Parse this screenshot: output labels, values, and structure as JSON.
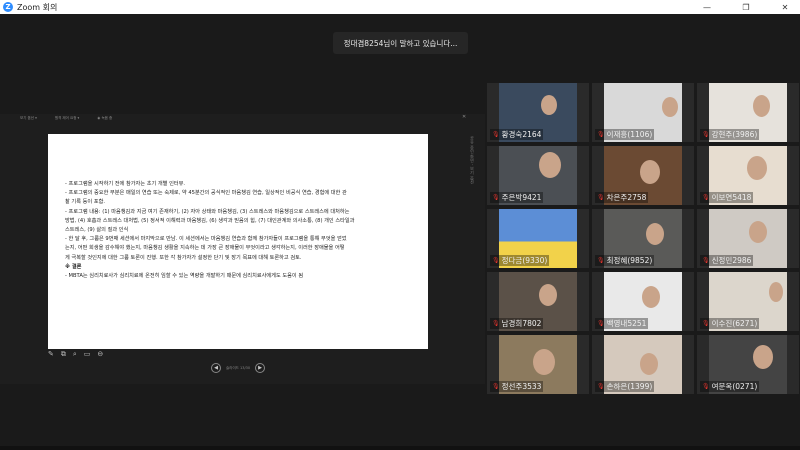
{
  "window": {
    "title": "Zoom 회의",
    "logo_letter": "Z",
    "controls": {
      "minimize": "—",
      "maximize": "❐",
      "close": "✕"
    }
  },
  "toast": {
    "text": "정대겸8254님이 말하고 있습니다..."
  },
  "share": {
    "tabs": [
      "보기 옵션 ▾",
      "원격 제어 요청 ▾",
      "◉ 녹음 중"
    ],
    "close": "✕",
    "side_caption": "공유 중인 화면 - 보기 옵션",
    "slide_lines": [
      "- 프로그램을 시작하기 전에 참가자는 초기 개별 인터뷰.",
      "- 프로그램의 중요한 부분은 매일의 연습 또는 숙제로, 약 45분간의 공식적인 마음챙김 연습, 일상적인 비공식 연습, 경험에 대한 관",
      "  찰 기록 등이 포함.",
      "- 프로그램 내용: (1) 마음챙김과 지금 여기 존재하기, (2) 자아 상태와 마음챙김, (3) 스트레스와 마음챙김으로 스트레스에 대처하는",
      "  방법, (4) 호흡과 스트레스 대처법, (5) 정서적 이해력과 마음챙김, (6) 생각과 믿음의 힘, (7) 대인관계와 의사소통, (8) 개인 스타일과",
      "  스트레스, (9) 삶의 질과 인식",
      "- 한 달 후, 그룹은 9번째 세션에서 마지막으로 만남. 이 세션에서는 마음챙김 연습과 함께 참가자들이 프로그램을 통해 무엇을 얻었",
      "  는지, 어떤 희생을 감수해야 했는지, 마음챙김 생활을 지속하는 데 가장 큰 장애물이 무엇이라고 생각하는지, 이러한 장애물을 어떻",
      "  게 극복할 것인지에 대한 그룹 토론이 진행. 또한 각 참가자가 설정한 단기 및 장기 목표에 대해 토론하고 검토.",
      "※ 결론",
      "- MBTA는 심리치료사가 심리치료에 온전히 임할 수 있는 역량을 개발하기 때문에 심리치료사에게도 도움이 됨"
    ],
    "tools": [
      "✎",
      "⧉",
      "⌕",
      "▭",
      "⊖"
    ],
    "pager": {
      "prev": "◀",
      "page": "슬라이드 13/30",
      "next": "▶"
    }
  },
  "participants": [
    {
      "name": "황경숙2164",
      "muted": true
    },
    {
      "name": "이재흥(1106)",
      "muted": true
    },
    {
      "name": "강현주(3986)",
      "muted": true
    },
    {
      "name": "주은박9421",
      "muted": true
    },
    {
      "name": "차은주2758",
      "muted": true
    },
    {
      "name": "이보연5418",
      "muted": true
    },
    {
      "name": "정다금(9330)",
      "muted": true
    },
    {
      "name": "최정혜(9852)",
      "muted": true
    },
    {
      "name": "신정민2986",
      "muted": true
    },
    {
      "name": "남경희7802",
      "muted": true
    },
    {
      "name": "백영내5251",
      "muted": true
    },
    {
      "name": "이수진(6271)",
      "muted": true
    },
    {
      "name": "정선주3533",
      "muted": true
    },
    {
      "name": "손하은(1399)",
      "muted": true
    },
    {
      "name": "여문옥(0271)",
      "muted": true
    }
  ],
  "icons": {
    "mic_muted": "🎙"
  }
}
